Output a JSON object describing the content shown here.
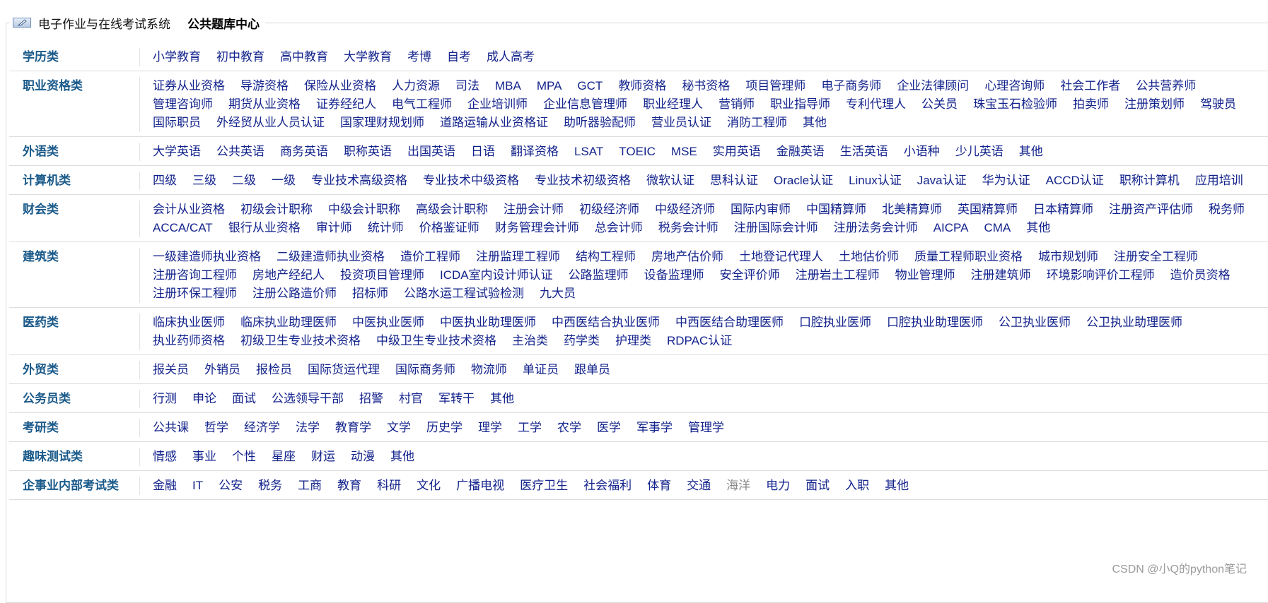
{
  "header": {
    "system_title": "电子作业与在线考试系统",
    "bank_title": "公共题库中心"
  },
  "categories": [
    {
      "name": "学历类",
      "items": [
        "小学教育",
        "初中教育",
        "高中教育",
        "大学教育",
        "考博",
        "自考",
        "成人高考"
      ]
    },
    {
      "name": "职业资格类",
      "items": [
        "证券从业资格",
        "导游资格",
        "保险从业资格",
        "人力资源",
        "司法",
        "MBA",
        "MPA",
        "GCT",
        "教师资格",
        "秘书资格",
        "项目管理师",
        "电子商务师",
        "企业法律顾问",
        "心理咨询师",
        "社会工作者",
        "公共营养师",
        "管理咨询师",
        "期货从业资格",
        "证券经纪人",
        "电气工程师",
        "企业培训师",
        "企业信息管理师",
        "职业经理人",
        "营销师",
        "职业指导师",
        "专利代理人",
        "公关员",
        "珠宝玉石检验师",
        "拍卖师",
        "注册策划师",
        "驾驶员",
        "国际职员",
        "外经贸从业人员认证",
        "国家理财规划师",
        "道路运输从业资格证",
        "助听器验配师",
        "营业员认证",
        "消防工程师",
        "其他"
      ]
    },
    {
      "name": "外语类",
      "items": [
        "大学英语",
        "公共英语",
        "商务英语",
        "职称英语",
        "出国英语",
        "日语",
        "翻译资格",
        "LSAT",
        "TOEIC",
        "MSE",
        "实用英语",
        "金融英语",
        "生活英语",
        "小语种",
        "少儿英语",
        "其他"
      ]
    },
    {
      "name": "计算机类",
      "items": [
        "四级",
        "三级",
        "二级",
        "一级",
        "专业技术高级资格",
        "专业技术中级资格",
        "专业技术初级资格",
        "微软认证",
        "思科认证",
        "Oracle认证",
        "Linux认证",
        "Java认证",
        "华为认证",
        "ACCD认证",
        "职称计算机",
        "应用培训"
      ]
    },
    {
      "name": "财会类",
      "items": [
        "会计从业资格",
        "初级会计职称",
        "中级会计职称",
        "高级会计职称",
        "注册会计师",
        "初级经济师",
        "中级经济师",
        "国际内审师",
        "中国精算师",
        "北美精算师",
        "英国精算师",
        "日本精算师",
        "注册资产评估师",
        "税务师",
        "ACCA/CAT",
        "银行从业资格",
        "审计师",
        "统计师",
        "价格鉴证师",
        "财务管理会计师",
        "总会计师",
        "税务会计师",
        "注册国际会计师",
        "注册法务会计师",
        "AICPA",
        "CMA",
        "其他"
      ]
    },
    {
      "name": "建筑类",
      "items": [
        "一级建造师执业资格",
        "二级建造师执业资格",
        "造价工程师",
        "注册监理工程师",
        "结构工程师",
        "房地产估价师",
        "土地登记代理人",
        "土地估价师",
        "质量工程师职业资格",
        "城市规划师",
        "注册安全工程师",
        "注册咨询工程师",
        "房地产经纪人",
        "投资项目管理师",
        "ICDA室内设计师认证",
        "公路监理师",
        "设备监理师",
        "安全评价师",
        "注册岩土工程师",
        "物业管理师",
        "注册建筑师",
        "环境影响评价工程师",
        "造价员资格",
        "注册环保工程师",
        "注册公路造价师",
        "招标师",
        "公路水运工程试验检测",
        "九大员"
      ]
    },
    {
      "name": "医药类",
      "items": [
        "临床执业医师",
        "临床执业助理医师",
        "中医执业医师",
        "中医执业助理医师",
        "中西医结合执业医师",
        "中西医结合助理医师",
        "口腔执业医师",
        "口腔执业助理医师",
        "公卫执业医师",
        "公卫执业助理医师",
        "执业药师资格",
        "初级卫生专业技术资格",
        "中级卫生专业技术资格",
        "主治类",
        "药学类",
        "护理类",
        "RDPAC认证"
      ]
    },
    {
      "name": "外贸类",
      "items": [
        "报关员",
        "外销员",
        "报检员",
        "国际货运代理",
        "国际商务师",
        "物流师",
        "单证员",
        "跟单员"
      ]
    },
    {
      "name": "公务员类",
      "items": [
        "行测",
        "申论",
        "面试",
        "公选领导干部",
        "招警",
        "村官",
        "军转干",
        "其他"
      ]
    },
    {
      "name": "考研类",
      "items": [
        "公共课",
        "哲学",
        "经济学",
        "法学",
        "教育学",
        "文学",
        "历史学",
        "理学",
        "工学",
        "农学",
        "医学",
        "军事学",
        "管理学"
      ]
    },
    {
      "name": "趣味测试类",
      "items": [
        "情感",
        "事业",
        "个性",
        "星座",
        "财运",
        "动漫",
        "其他"
      ]
    },
    {
      "name": "企事业内部考试类",
      "items": [
        "金融",
        "IT",
        "公安",
        "税务",
        "工商",
        "教育",
        "科研",
        "文化",
        "广播电视",
        "医疗卫生",
        "社会福利",
        "体育",
        "交通",
        "海洋",
        "电力",
        "面试",
        "入职",
        "其他"
      ]
    }
  ],
  "watermark": "CSDN @小Q的python笔记"
}
